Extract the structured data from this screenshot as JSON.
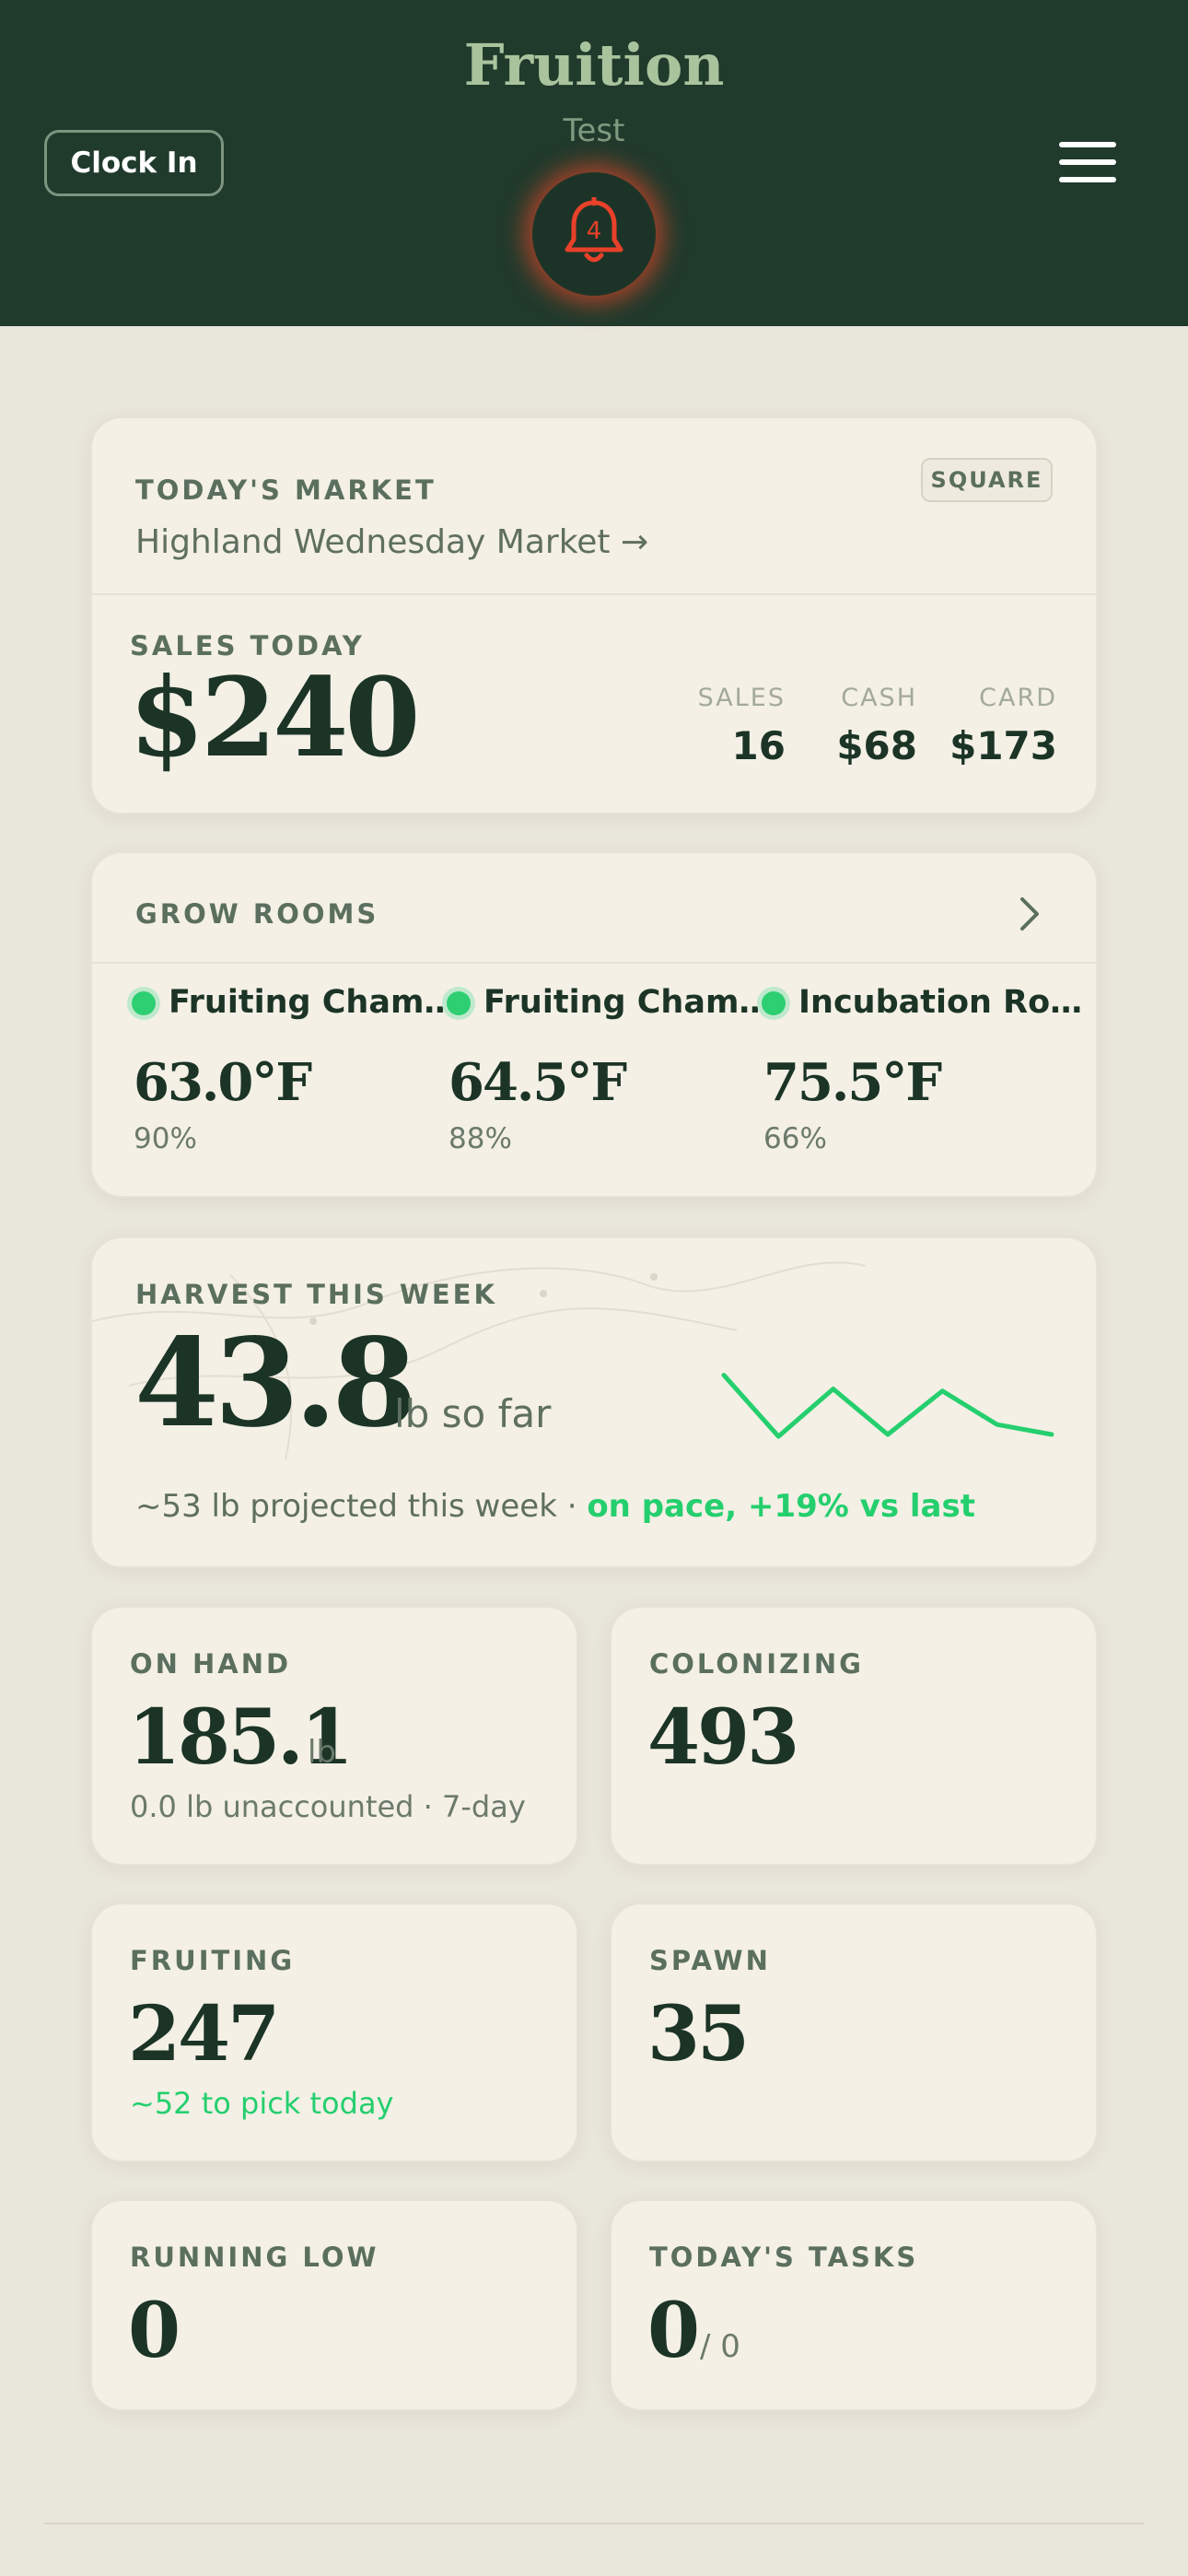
{
  "header": {
    "brand": "Fruition",
    "subtitle": "Test",
    "clock_label": "Clock In",
    "notification_count": "4",
    "colors": {
      "bg": "#203a2c",
      "brand": "#a9c49d",
      "bell": "#e8412a"
    }
  },
  "market": {
    "label": "TODAY'S MARKET",
    "badge": "SQUARE",
    "name": "Highland Wednesday Market →",
    "sales_label": "SALES TODAY",
    "total": "$240",
    "stats": [
      {
        "label": "SALES",
        "value": "16"
      },
      {
        "label": "CASH",
        "value": "$68"
      },
      {
        "label": "CARD",
        "value": "$173"
      }
    ]
  },
  "grow_rooms": {
    "label": "GROW ROOMS",
    "rooms": [
      {
        "name": "Fruiting Cham…",
        "temp": "63.0°F",
        "humidity": "90%",
        "status": "green"
      },
      {
        "name": "Fruiting Cham…",
        "temp": "64.5°F",
        "humidity": "88%",
        "status": "green"
      },
      {
        "name": "Incubation Ro…",
        "temp": "75.5°F",
        "humidity": "66%",
        "status": "green"
      }
    ]
  },
  "harvest": {
    "label": "HARVEST THIS WEEK",
    "value": "43.8",
    "unit": "lb so far",
    "projection": "~53 lb projected this week · ",
    "pace": "on pace, +19% vs last",
    "sparkline": [
      7.2,
      4.1,
      6.5,
      4.2,
      6.4,
      4.7,
      4.2
    ],
    "accent": "#25cf6e"
  },
  "tiles": {
    "on_hand": {
      "label": "ON HAND",
      "value": "185.1",
      "unit": "lb",
      "sub": "0.0 lb unaccounted · 7-day"
    },
    "colonizing": {
      "label": "COLONIZING",
      "value": "493"
    },
    "fruiting": {
      "label": "FRUITING",
      "value": "247",
      "sub": "~52 to pick today"
    },
    "spawn": {
      "label": "SPAWN",
      "value": "35"
    },
    "running_low": {
      "label": "RUNNING LOW",
      "value": "0"
    },
    "tasks": {
      "label": "TODAY'S TASKS",
      "value": "0",
      "total": "/ 0"
    }
  }
}
